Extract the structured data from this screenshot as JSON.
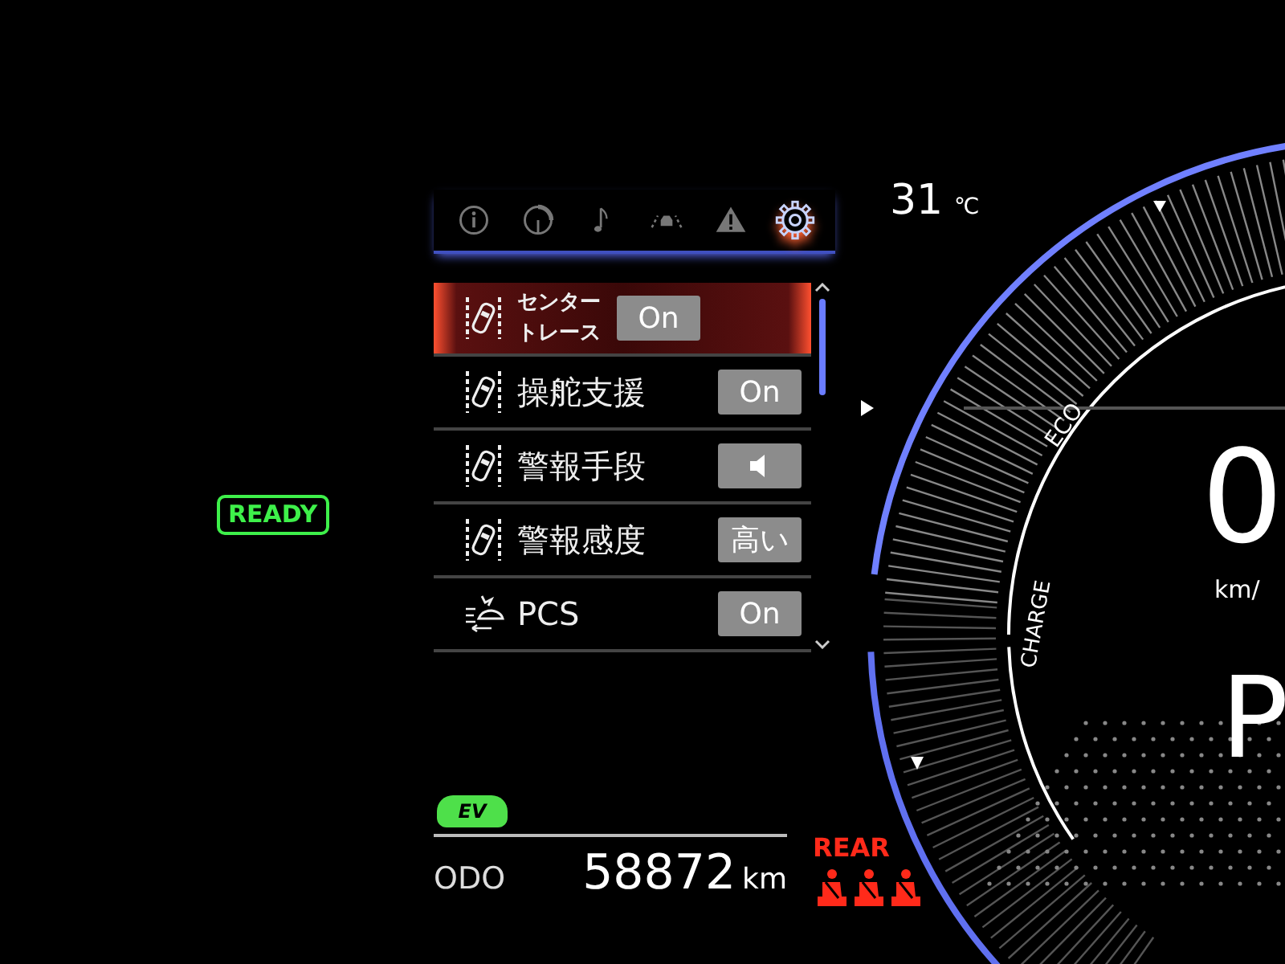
{
  "ready_indicator": {
    "text": "READY"
  },
  "tabs": [
    {
      "kind": "info",
      "selected": false
    },
    {
      "kind": "gauge",
      "selected": false
    },
    {
      "kind": "music",
      "selected": false
    },
    {
      "kind": "car",
      "selected": false
    },
    {
      "kind": "warning",
      "selected": false
    },
    {
      "kind": "settings",
      "selected": true
    }
  ],
  "menu_items": [
    {
      "kind": "lane",
      "label": "センタートレース",
      "value": {
        "kind": "text",
        "text": "On"
      },
      "selected": true
    },
    {
      "kind": "lane",
      "label": "操舵支援",
      "value": {
        "kind": "text",
        "text": "On"
      },
      "selected": false
    },
    {
      "kind": "lane",
      "label": "警報手段",
      "value": {
        "kind": "speaker"
      },
      "selected": false
    },
    {
      "kind": "lane",
      "label": "警報感度",
      "value": {
        "kind": "text",
        "text": "高い"
      },
      "selected": false
    },
    {
      "kind": "pcs",
      "label": "PCS",
      "value": {
        "kind": "text",
        "text": "On"
      },
      "selected": false
    }
  ],
  "ev_badge": {
    "text": "EV"
  },
  "odometer": {
    "label": "ODO",
    "value": "58872",
    "unit": "km"
  },
  "seatbelt_warning": {
    "label": "REAR",
    "seats": [
      {
        "kind": "seatbelt"
      },
      {
        "kind": "seatbelt"
      },
      {
        "kind": "seatbelt"
      }
    ]
  },
  "temperature": {
    "value": "31",
    "unit": "℃"
  },
  "gauge": {
    "eco_label": "ECO",
    "charge_label": "CHARGE",
    "speed": "0",
    "speed_unit": "km/",
    "gear": "P"
  }
}
